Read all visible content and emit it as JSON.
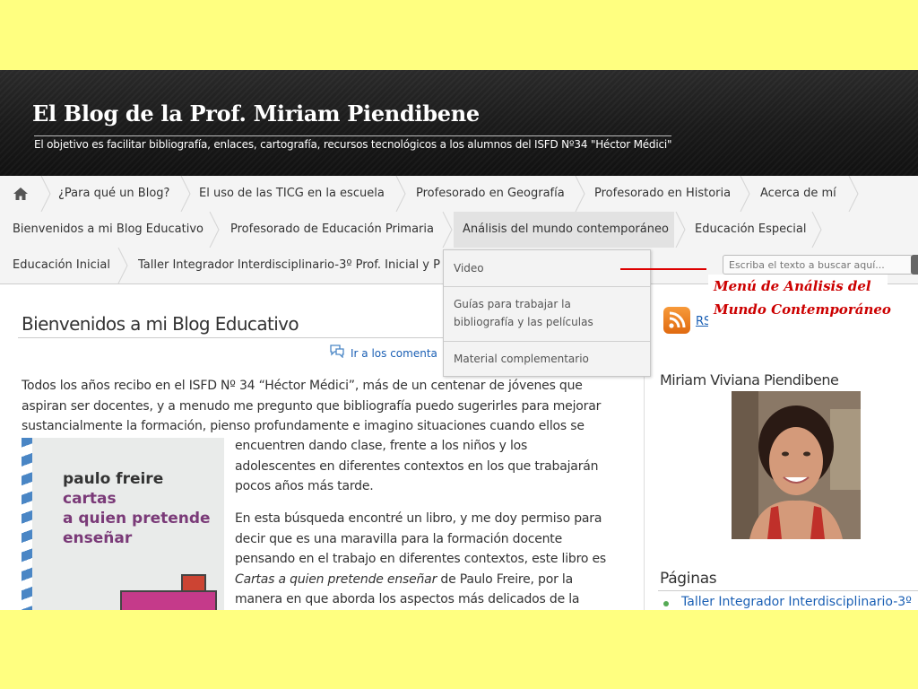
{
  "header": {
    "title": "El Blog de la Prof. Miriam Piendibene",
    "description": "El objetivo es facilitar bibliografía, enlaces, cartografía, recursos tecnológicos a los alumnos del ISFD Nº34 \"Héctor Médici\""
  },
  "nav": {
    "home_icon": "home-icon",
    "row1": [
      "¿Para qué un Blog?",
      "El uso de las TICG en la escuela",
      "Profesorado en Geografía",
      "Profesorado en Historia",
      "Acerca de mí"
    ],
    "row2": [
      "Bienvenidos a mi Blog Educativo",
      "Profesorado de Educación Primaria",
      "Análisis del mundo contemporáneo",
      "Educación Especial"
    ],
    "row3": [
      "Educación Inicial",
      "Taller Integrador Interdisciplinario-3º Prof. Inicial y P"
    ]
  },
  "dropdown": {
    "items": [
      "Video",
      "Guías para trabajar la",
      "bibliografía y las películas",
      "Material complementario"
    ]
  },
  "search": {
    "placeholder": "Escriba el texto a buscar aquí..."
  },
  "annotation": {
    "line1": "Menú de Análisis del",
    "line2": "Mundo Contemporáneo",
    "color": "#cc0000"
  },
  "post": {
    "title": "Bienvenidos a mi Blog Educativo",
    "comments_link": "Ir a los comenta",
    "p1": [
      "Todos los años recibo en el ISFD Nº 34 “Héctor Médici”, más de un centenar de jóvenes que",
      "aspiran ser docentes, y a menudo me pregunto que bibliografía puedo sugerirles para mejorar",
      "sustancialmente la formación, pienso profundamente e imagino situaciones cuando ellos se"
    ],
    "p2": [
      "encuentren dando clase, frente a los niños y los",
      "adolescentes en diferentes contextos en los que trabajarán",
      "pocos años más tarde."
    ],
    "p3": [
      "En esta búsqueda encontré un libro, y me doy permiso para",
      "decir que es una maravilla para la formación docente",
      "pensando en el trabajo en diferentes contextos, este libro es",
      "de Paulo Freire, por la",
      "manera en que aborda los aspectos más delicados de la"
    ],
    "p3_italic": "Cartas a quien pretende enseñar",
    "book": {
      "author": "paulo freire",
      "title_lines": [
        "cartas",
        "a quien pretende",
        "enseñar"
      ]
    }
  },
  "sidebar": {
    "rss_label": "RS",
    "profile_name": "Miriam Viviana Piendibene",
    "pages_title": "Páginas",
    "pages_item": "Taller Integrador Interdisciplinario-3º"
  },
  "colors": {
    "background": "#ffff80",
    "link": "#1a5fb4",
    "header": "#1a1a1a"
  }
}
